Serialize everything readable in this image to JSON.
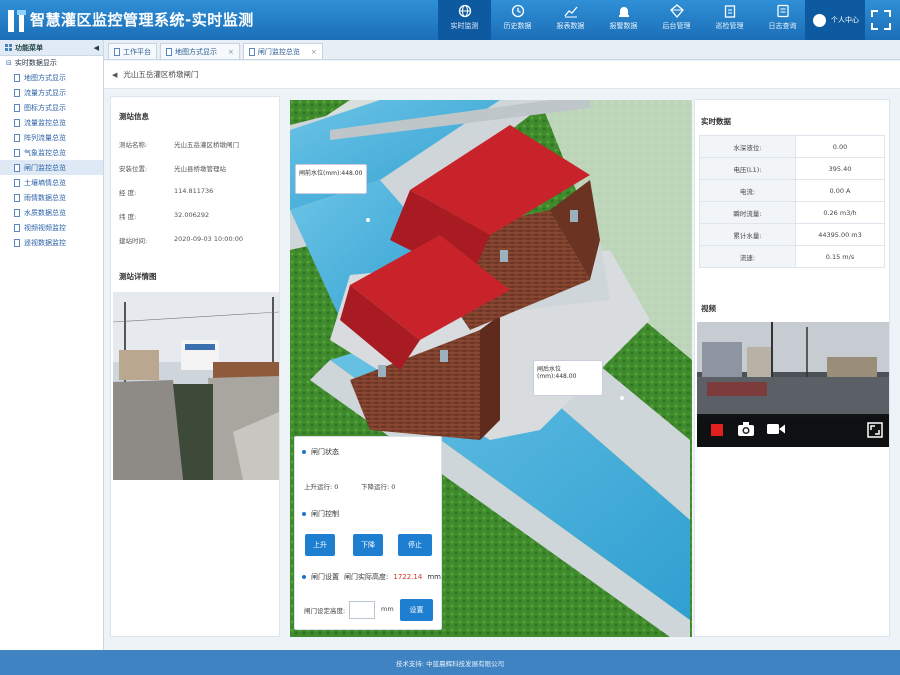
{
  "header": {
    "title": "智慧灌区监控管理系统-实时监测",
    "nav": [
      {
        "label": "实时监测",
        "icon": "globe-icon",
        "active": true
      },
      {
        "label": "历史数据",
        "icon": "history-icon"
      },
      {
        "label": "报表数据",
        "icon": "chart-icon"
      },
      {
        "label": "报警数据",
        "icon": "alarm-icon"
      },
      {
        "label": "后台管理",
        "icon": "diamond-icon"
      },
      {
        "label": "巡检管理",
        "icon": "clipboard-icon"
      },
      {
        "label": "日志查询",
        "icon": "log-icon"
      }
    ],
    "user": "个人中心",
    "accent": "#1b6fb8"
  },
  "sidebar": {
    "title": "功能菜单",
    "group": "实时数据显示",
    "items": [
      "地图方式显示",
      "流量方式显示",
      "图标方式显示",
      "流量监控总览",
      "阵列流量总览",
      "气象监控总览",
      "闸门监控总览",
      "土壤墒情总览",
      "雨情数据总览",
      "水质数据总览",
      "视频视频监控",
      "遥视数据监控"
    ],
    "selected_index": 6
  },
  "tabs": [
    {
      "label": "工作平台"
    },
    {
      "label": "地图方式显示"
    },
    {
      "label": "闸门监控总览",
      "active": true
    }
  ],
  "breadcrumb": "光山五岳灌区桥墩闸门",
  "station": {
    "section_title": "测站信息",
    "fields": [
      {
        "k": "测站名称:",
        "v": "光山五岳灌区桥墩闸门"
      },
      {
        "k": "安装位置:",
        "v": "光山县桥墩管理站"
      },
      {
        "k": "经    度:",
        "v": "114.811736"
      },
      {
        "k": "纬    度:",
        "v": "32.006292"
      },
      {
        "k": "建站时间:",
        "v": "2020-09-03 10:00:00"
      }
    ],
    "photo_title": "测站详情图"
  },
  "scene": {
    "label_upper": "闸前水位(mm):448.00",
    "label_lower": "闸后水位(mm):448.00"
  },
  "gate": {
    "status_title": "闸门状态",
    "up_status": "上升运行: 0",
    "down_status": "下降运行: 0",
    "control_title": "闸门控制",
    "btn_up": "上升",
    "btn_down": "下降",
    "btn_stop": "停止",
    "setting_title": "闸门设置",
    "height_label": "闸门实际高度:",
    "height_value": "1722.14",
    "height_unit": "mm",
    "set_label": "闸门设定高度:",
    "set_unit": "mm",
    "set_btn": "设置",
    "highlight": "#d9312b"
  },
  "realtime": {
    "title": "实时数据",
    "rows": [
      {
        "k": "水深液位:",
        "v": "0.00"
      },
      {
        "k": "电压(L1):",
        "v": "395.40"
      },
      {
        "k": "电流:",
        "v": "0.00 A"
      },
      {
        "k": "瞬时流量:",
        "v": "0.26 m3/h"
      },
      {
        "k": "累计水量:",
        "v": "44395.00 m3"
      },
      {
        "k": "流速:",
        "v": "0.15 m/s"
      }
    ],
    "video_title": "视频"
  },
  "footer": "技术支持: 中蓝晨辉科技发展有限公司"
}
